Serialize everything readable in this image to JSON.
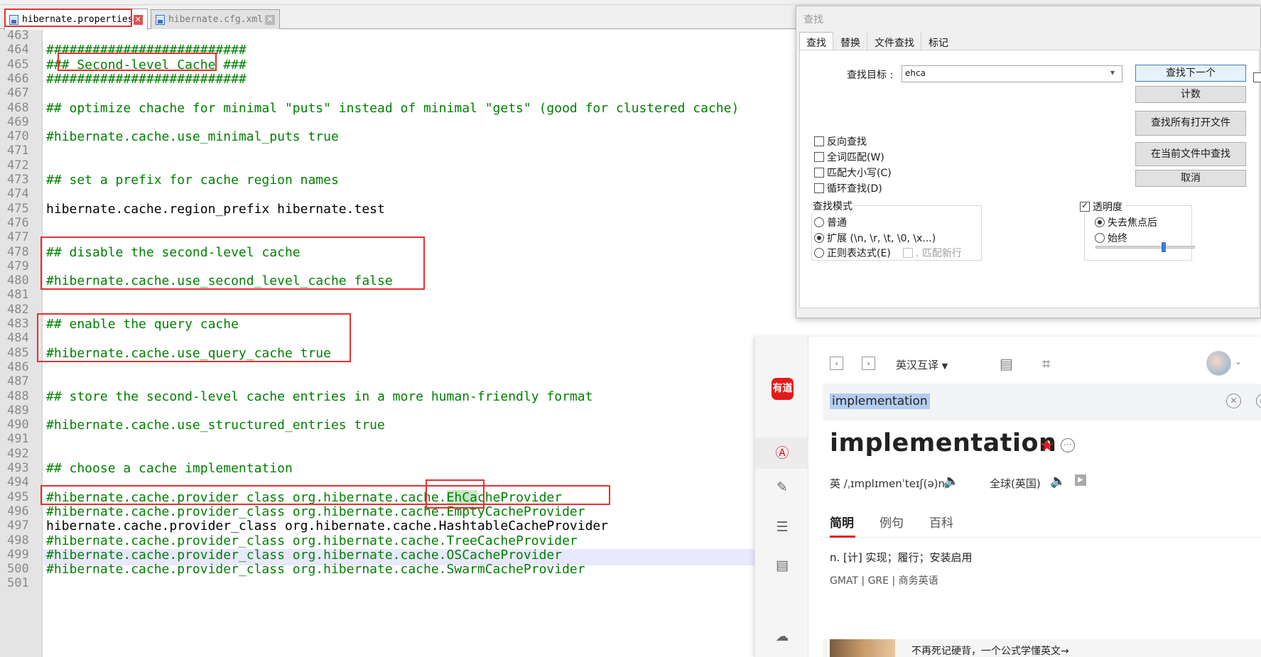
{
  "editor": {
    "tabs": [
      {
        "label": "hibernate.properties",
        "close": "✕"
      },
      {
        "label": "hibernate.cfg.xml",
        "close": "✕"
      }
    ],
    "lines": [
      {
        "n": "463",
        "text": "",
        "cls": "cm"
      },
      {
        "n": "464",
        "text": "##########################",
        "cls": "cm"
      },
      {
        "n": "465",
        "text": "### Second-level Cache ###",
        "cls": "cm"
      },
      {
        "n": "466",
        "text": "##########################",
        "cls": "cm"
      },
      {
        "n": "467",
        "text": "",
        "cls": "cm"
      },
      {
        "n": "468",
        "text": "## optimize chache for minimal \"puts\" instead of minimal \"gets\" (good for clustered cache)",
        "cls": "cm"
      },
      {
        "n": "469",
        "text": "",
        "cls": "cm"
      },
      {
        "n": "470",
        "text": "#hibernate.cache.use_minimal_puts true",
        "cls": "cm"
      },
      {
        "n": "471",
        "text": "",
        "cls": "cm"
      },
      {
        "n": "472",
        "text": "",
        "cls": "cm"
      },
      {
        "n": "473",
        "text": "## set a prefix for cache region names",
        "cls": "cm"
      },
      {
        "n": "474",
        "text": "",
        "cls": "cm"
      },
      {
        "n": "475",
        "text": "hibernate.cache.region_prefix hibernate.test",
        "cls": "pl"
      },
      {
        "n": "476",
        "text": "",
        "cls": "cm"
      },
      {
        "n": "477",
        "text": "",
        "cls": "cm"
      },
      {
        "n": "478",
        "text": "## disable the second-level cache",
        "cls": "cm"
      },
      {
        "n": "479",
        "text": "",
        "cls": "cm"
      },
      {
        "n": "480",
        "text": "#hibernate.cache.use_second_level_cache false",
        "cls": "cm"
      },
      {
        "n": "481",
        "text": "",
        "cls": "cm"
      },
      {
        "n": "482",
        "text": "",
        "cls": "cm"
      },
      {
        "n": "483",
        "text": "## enable the query cache",
        "cls": "cm"
      },
      {
        "n": "484",
        "text": "",
        "cls": "cm"
      },
      {
        "n": "485",
        "text": "#hibernate.cache.use_query_cache true",
        "cls": "cm"
      },
      {
        "n": "486",
        "text": "",
        "cls": "cm"
      },
      {
        "n": "487",
        "text": "",
        "cls": "cm"
      },
      {
        "n": "488",
        "text": "## store the second-level cache entries in a more human-friendly format",
        "cls": "cm"
      },
      {
        "n": "489",
        "text": "",
        "cls": "cm"
      },
      {
        "n": "490",
        "text": "#hibernate.cache.use_structured_entries true",
        "cls": "cm"
      },
      {
        "n": "491",
        "text": "",
        "cls": "cm"
      },
      {
        "n": "492",
        "text": "",
        "cls": "cm"
      },
      {
        "n": "493",
        "text": "## choose a cache implementation",
        "cls": "cm"
      },
      {
        "n": "494",
        "text": "",
        "cls": "cm"
      },
      {
        "n": "495",
        "text": "#hibernate.cache.provider_class org.hibernate.cache.",
        "mark": "EhCa",
        "rest": "cheProvider",
        "cls": "cm"
      },
      {
        "n": "496",
        "text": "#hibernate.cache.provider_class org.hibernate.cache.EmptyCacheProvider",
        "cls": "cm"
      },
      {
        "n": "497",
        "text": "hibernate.cache.provider_class org.hibernate.cache.HashtableCacheProvider",
        "cls": "pl"
      },
      {
        "n": "498",
        "text": "#hibernate.cache.provider_class org.hibernate.cache.TreeCacheProvider",
        "cls": "cm"
      },
      {
        "n": "499",
        "text": "#hibernate.cache.provider_class org.hibernate.cache.OSCacheProvider",
        "cls": "cm"
      },
      {
        "n": "500",
        "text": "#hibernate.cache.provider_class org.hibernate.cache.SwarmCacheProvider",
        "cls": "cm"
      },
      {
        "n": "501",
        "text": "",
        "cls": "cm"
      }
    ]
  },
  "find": {
    "title": "查找",
    "tabs": [
      "查找",
      "替换",
      "文件查找",
      "标记"
    ],
    "target_label": "查找目标 :",
    "target_value": "ehca",
    "buttons": [
      "查找下一个",
      "计数",
      "查找所有打开文件",
      "在当前文件中查找",
      "取消"
    ],
    "options": [
      "反向查找",
      "全词匹配(W)",
      "匹配大小写(C)",
      "循环查找(D)"
    ],
    "mode_label": "查找模式",
    "modes": [
      "普通",
      "扩展 (\\n, \\r, \\t, \\0, \\x...)",
      "正则表达式(E)"
    ],
    "match_newline": ". 匹配新行",
    "transparency_label": "透明度",
    "transparency_modes": [
      "失去焦点后",
      "始终"
    ],
    "transparency_level": 0.7
  },
  "dict": {
    "logo": "有道",
    "mode": "英汉互译",
    "search_value": "implementation",
    "headword": "implementation",
    "phonetic_uk": "英 /ˌɪmplɪmenˈteɪʃ(ə)n/",
    "phonetic_global": "全球(英国)",
    "tabs": [
      "简明",
      "例句",
      "百科"
    ],
    "definition": "n. [计] 实现；履行；安装启用",
    "tags": "GMAT | GRE | 商务英语",
    "promo_text": "不再死记硬背，一个公式学懂英文→",
    "icons": [
      "chevron-left-icon",
      "chevron-right-icon",
      "document-icon",
      "camera-icon",
      "clear-icon",
      "history-icon",
      "star-icon",
      "more-icon",
      "speaker-icon",
      "play-icon"
    ]
  }
}
